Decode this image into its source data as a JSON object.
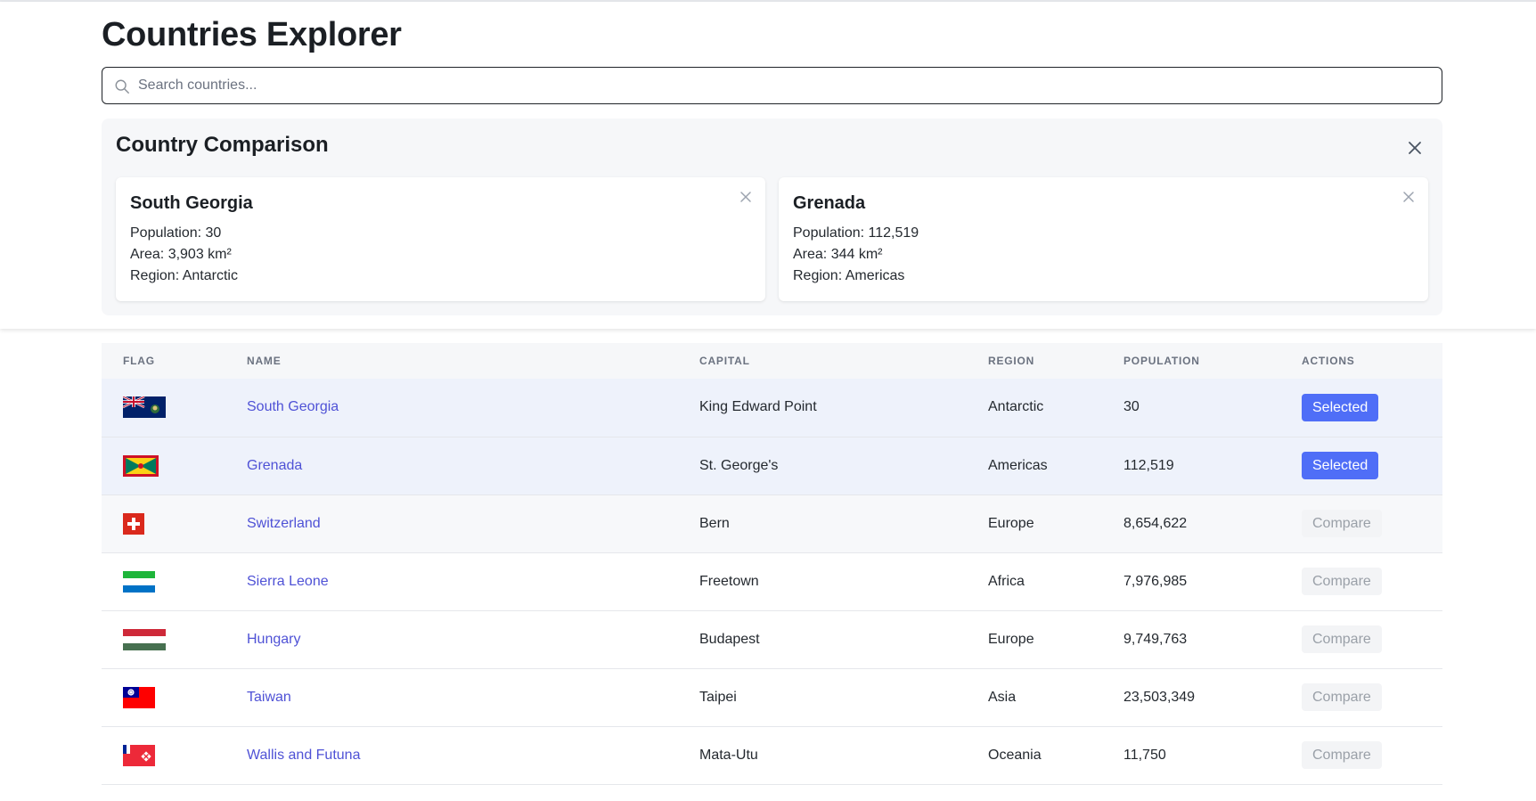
{
  "page": {
    "title": "Countries Explorer"
  },
  "search": {
    "placeholder": "Search countries..."
  },
  "comparison": {
    "title": "Country Comparison",
    "cards": [
      {
        "name": "South Georgia",
        "population": "Population: 30",
        "area": "Area: 3,903 km²",
        "region": "Region: Antarctic"
      },
      {
        "name": "Grenada",
        "population": "Population: 112,519",
        "area": "Area: 344 km²",
        "region": "Region: Americas"
      }
    ]
  },
  "table": {
    "headers": {
      "flag": "FLAG",
      "name": "NAME",
      "capital": "CAPITAL",
      "region": "REGION",
      "population": "POPULATION",
      "actions": "ACTIONS"
    },
    "rows": [
      {
        "flag": "South Georgia flag",
        "name": "South Georgia",
        "capital": "King Edward Point",
        "region": "Antarctic",
        "population": "30",
        "action": "Selected",
        "state": "selected"
      },
      {
        "flag": "Grenada flag",
        "name": "Grenada",
        "capital": "St. George's",
        "region": "Americas",
        "population": "112,519",
        "action": "Selected",
        "state": "selected"
      },
      {
        "flag": "Switzerland flag",
        "name": "Switzerland",
        "capital": "Bern",
        "region": "Europe",
        "population": "8,654,622",
        "action": "Compare",
        "state": "hover"
      },
      {
        "flag": "Sierra Leone flag",
        "name": "Sierra Leone",
        "capital": "Freetown",
        "region": "Africa",
        "population": "7,976,985",
        "action": "Compare",
        "state": "normal"
      },
      {
        "flag": "Hungary flag",
        "name": "Hungary",
        "capital": "Budapest",
        "region": "Europe",
        "population": "9,749,763",
        "action": "Compare",
        "state": "normal"
      },
      {
        "flag": "Taiwan flag",
        "name": "Taiwan",
        "capital": "Taipei",
        "region": "Asia",
        "population": "23,503,349",
        "action": "Compare",
        "state": "normal"
      },
      {
        "flag": "Wallis and Futuna flag",
        "name": "Wallis and Futuna",
        "capital": "Mata-Utu",
        "region": "Oceania",
        "population": "11,750",
        "action": "Compare",
        "state": "normal"
      }
    ]
  },
  "colors": {
    "accent": "#4f6ef7",
    "link": "#4f52d6",
    "selected_row": "#eef2fb",
    "panel_bg": "#f6f7f9"
  }
}
